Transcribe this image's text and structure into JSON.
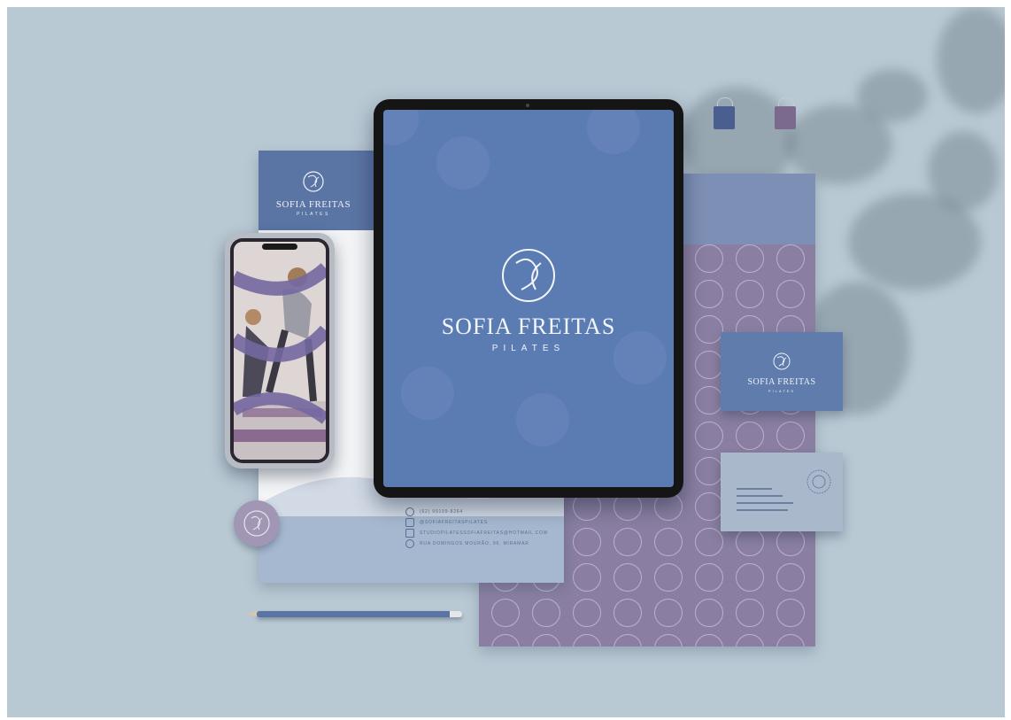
{
  "brand": {
    "name": "SOFIA FREITAS",
    "subtitle": "PILATES"
  },
  "contacts": [
    "(62) 99199-8264",
    "@SOFIAFREITASPILATES",
    "STUDIOPILATESSOFIAFREITAS@HOTMAIL.COM",
    "RUA DOMINGOS MOURÃO, 96, MIRAMAR"
  ],
  "colors": {
    "background": "#b9c9d4",
    "brand_blue": "#5b7bb3",
    "brand_purple": "#8a7fa2",
    "light_blue": "#a6b8cf"
  },
  "icons": [
    "whatsapp-icon",
    "instagram-icon",
    "mail-icon",
    "location-pin-icon"
  ]
}
